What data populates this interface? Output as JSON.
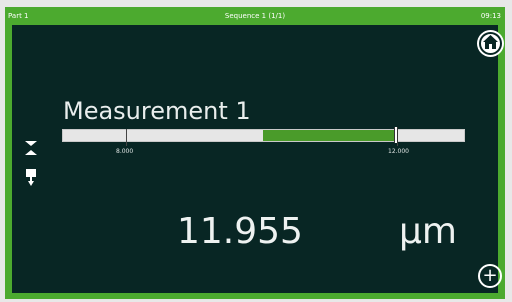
{
  "header": {
    "part": "Part 1",
    "sequence": "Sequence 1 (1/1)",
    "time": "09:13"
  },
  "measurement": {
    "title": "Measurement 1",
    "lower_limit_label": "8.000",
    "upper_limit_label": "12.000",
    "lower_limit": 8.0,
    "upper_limit": 12.0,
    "value": "11.955",
    "value_number": 11.955,
    "unit": "µm"
  },
  "icons": {
    "home": "home-icon",
    "add": "plus-icon",
    "collapse": "collapse-expand-icon",
    "probe": "probe-icon"
  },
  "colors": {
    "frame": "#4caa2f",
    "panel": "#082624",
    "tolerance_fill": "#4a9b2a"
  },
  "add_label": "+"
}
